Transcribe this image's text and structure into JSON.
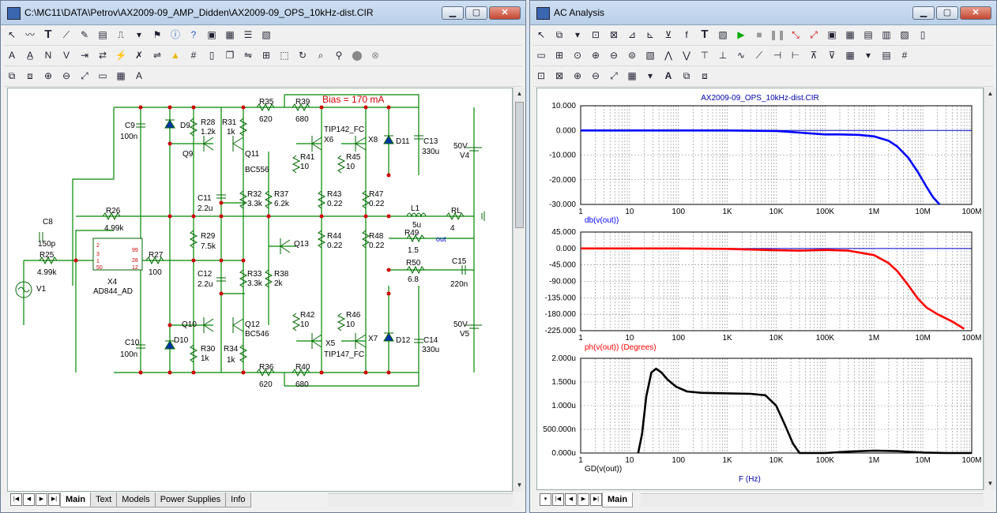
{
  "schematic_window": {
    "title": "C:\\MC11\\DATA\\Petrov\\AX2009-09_AMP_Didden\\AX2009-09_OPS_10kHz-dist.CIR",
    "tabs": [
      "Main",
      "Text",
      "Models",
      "Power Supplies",
      "Info"
    ],
    "active_tab": "Main",
    "bias_label": "Bias = 170 mA",
    "components": {
      "R35": "R35",
      "R35v": "620",
      "R39": "R39",
      "R39v": "680",
      "C9": "C9",
      "C9v": "100n",
      "D9": "D9",
      "R28": "R28",
      "R28v": "1.2k",
      "R31": "R31",
      "R31v": "1k",
      "Q9": "Q9",
      "Q11": "Q11",
      "Q11m": "BC556",
      "TIP142": "TIP142_FC",
      "X6": "X6",
      "X8": "X8",
      "D11": "D11",
      "C13": "C13",
      "C13v": "330u",
      "R41": "R41",
      "R41v": "10",
      "R45": "R45",
      "R45v": "10",
      "V4": "V4",
      "V4v": "50V",
      "C11": "C11",
      "C11v": "2.2u",
      "R32": "R32",
      "R32v": "3.3k",
      "R37": "R37",
      "R37v": "6.2k",
      "R43": "R43",
      "R43v": "0.22",
      "R47": "R47",
      "R47v": "0.22",
      "R26": "R26",
      "R26v": "4.99k",
      "L1": "L1",
      "L1v": "5u",
      "RL": "RL",
      "RLv": "4",
      "C8": "C8",
      "C8v": "150p",
      "R49": "R49",
      "R49v": "1.5",
      "out": "out",
      "R25": "R25",
      "R25v": "4.99k",
      "R27": "R27",
      "R27v": "100",
      "R29": "R29",
      "R29v": "7.5k",
      "Q13": "Q13",
      "R44": "R44",
      "R44v": "0.22",
      "R48": "R48",
      "R48v": "0.22",
      "R50": "R50",
      "R50v": "6.8",
      "C15": "C15",
      "C15v": "220n",
      "X4": "X4",
      "X4m": "AD844_AD",
      "V1": "V1",
      "C12": "C12",
      "C12v": "2.2u",
      "R33": "R33",
      "R33v": "3.3k",
      "R38": "R38",
      "R38v": "2k",
      "Q10": "Q10",
      "Q12": "Q12",
      "Q12m": "BC546",
      "R42": "R42",
      "R42v": "10",
      "R46": "R46",
      "R46v": "10",
      "V5": "V5",
      "V5v": "50V",
      "C10": "C10",
      "C10v": "100n",
      "D10": "D10",
      "R30": "R30",
      "R30v": "1k",
      "R34": "R34",
      "R34v": "1k",
      "X5": "X5",
      "X7": "X7",
      "TIP147": "TIP147_FC",
      "D12": "D12",
      "C14": "C14",
      "C14v": "330u",
      "R36": "R36",
      "R36v": "620",
      "R40": "R40",
      "R40v": "680",
      "pin2": "2",
      "pin3": "3",
      "pin1": "1",
      "pin50": "50",
      "pin99": "99",
      "pin28": "28",
      "pin12": "12"
    }
  },
  "analysis_window": {
    "title": "AC Analysis",
    "tabs": [
      "Main"
    ],
    "plot_title": "AX2009-09_OPS_10kHz-dist.CIR",
    "x_axis_label": "F (Hz)",
    "colors": {
      "db": "#0000ff",
      "ph": "#ff0000",
      "gd": "#000000",
      "axis_label_db": "#0000ff",
      "axis_label_ph": "#ff0000"
    }
  },
  "chart_data": [
    {
      "type": "line",
      "ylabel": "db(v(out))",
      "xscale": "log",
      "xlim": [
        1,
        100000000
      ],
      "x_ticks": [
        "1",
        "10",
        "100",
        "1K",
        "10K",
        "100K",
        "1M",
        "10M",
        "100M"
      ],
      "ylim": [
        -30,
        10
      ],
      "y_ticks": [
        "10.000",
        "0.000",
        "-10.000",
        "-20.000",
        "-30.000"
      ],
      "grid": true,
      "series": [
        {
          "name": "db(v(out))",
          "color": "#0000ff",
          "x": [
            1,
            10,
            100,
            1000,
            10000,
            50000,
            100000,
            200000,
            500000,
            1000000,
            2000000,
            3000000,
            5000000,
            8000000,
            12000000,
            16000000,
            22000000
          ],
          "y": [
            0,
            0,
            0,
            0,
            -0.2,
            -1.2,
            -1.6,
            -1.6,
            -1.8,
            -2.4,
            -4.2,
            -6.5,
            -11,
            -17,
            -23,
            -27,
            -31
          ]
        }
      ]
    },
    {
      "type": "line",
      "ylabel": "ph(v(out)) (Degrees)",
      "xscale": "log",
      "xlim": [
        1,
        100000000
      ],
      "x_ticks": [
        "1",
        "10",
        "100",
        "1K",
        "10K",
        "100K",
        "1M",
        "10M",
        "100M"
      ],
      "ylim": [
        -225,
        45
      ],
      "y_ticks": [
        "45.000",
        "0.000",
        "-45.000",
        "-90.000",
        "-135.000",
        "-180.000",
        "-225.000"
      ],
      "grid": true,
      "series": [
        {
          "name": "ph(v(out))",
          "color": "#ff0000",
          "x": [
            1,
            100,
            1000,
            3000,
            10000,
            30000,
            100000,
            300000,
            1000000,
            2000000,
            3000000,
            5000000,
            8000000,
            12000000,
            20000000,
            40000000,
            70000000
          ],
          "y": [
            0,
            0,
            -1,
            -3,
            -5,
            -6,
            -4,
            -6,
            -18,
            -40,
            -62,
            -100,
            -138,
            -162,
            -180,
            -200,
            -220
          ]
        }
      ]
    },
    {
      "type": "line",
      "ylabel": "GD(v(out))",
      "xlabel": "F (Hz)",
      "xscale": "log",
      "xlim": [
        1,
        100000000
      ],
      "x_ticks": [
        "1",
        "10",
        "100",
        "1K",
        "10K",
        "100K",
        "1M",
        "10M",
        "100M"
      ],
      "ylim": [
        0,
        2
      ],
      "y_ticks": [
        "2.000u",
        "1.500u",
        "1.000u",
        "500.000n",
        "0.000u"
      ],
      "grid": true,
      "series": [
        {
          "name": "GD(v(out))",
          "color": "#000000",
          "x": [
            15,
            18,
            22,
            28,
            35,
            45,
            60,
            90,
            150,
            300,
            1000,
            3000,
            6000,
            10000,
            15000,
            22000,
            30000,
            100000,
            300000,
            1000000,
            3000000,
            10000000,
            30000000,
            100000000
          ],
          "y": [
            0,
            0.4,
            1.2,
            1.7,
            1.78,
            1.7,
            1.55,
            1.4,
            1.3,
            1.27,
            1.26,
            1.25,
            1.22,
            1.0,
            0.6,
            0.2,
            0,
            0,
            0.03,
            0.05,
            0.04,
            0.01,
            0,
            0
          ]
        }
      ]
    }
  ]
}
